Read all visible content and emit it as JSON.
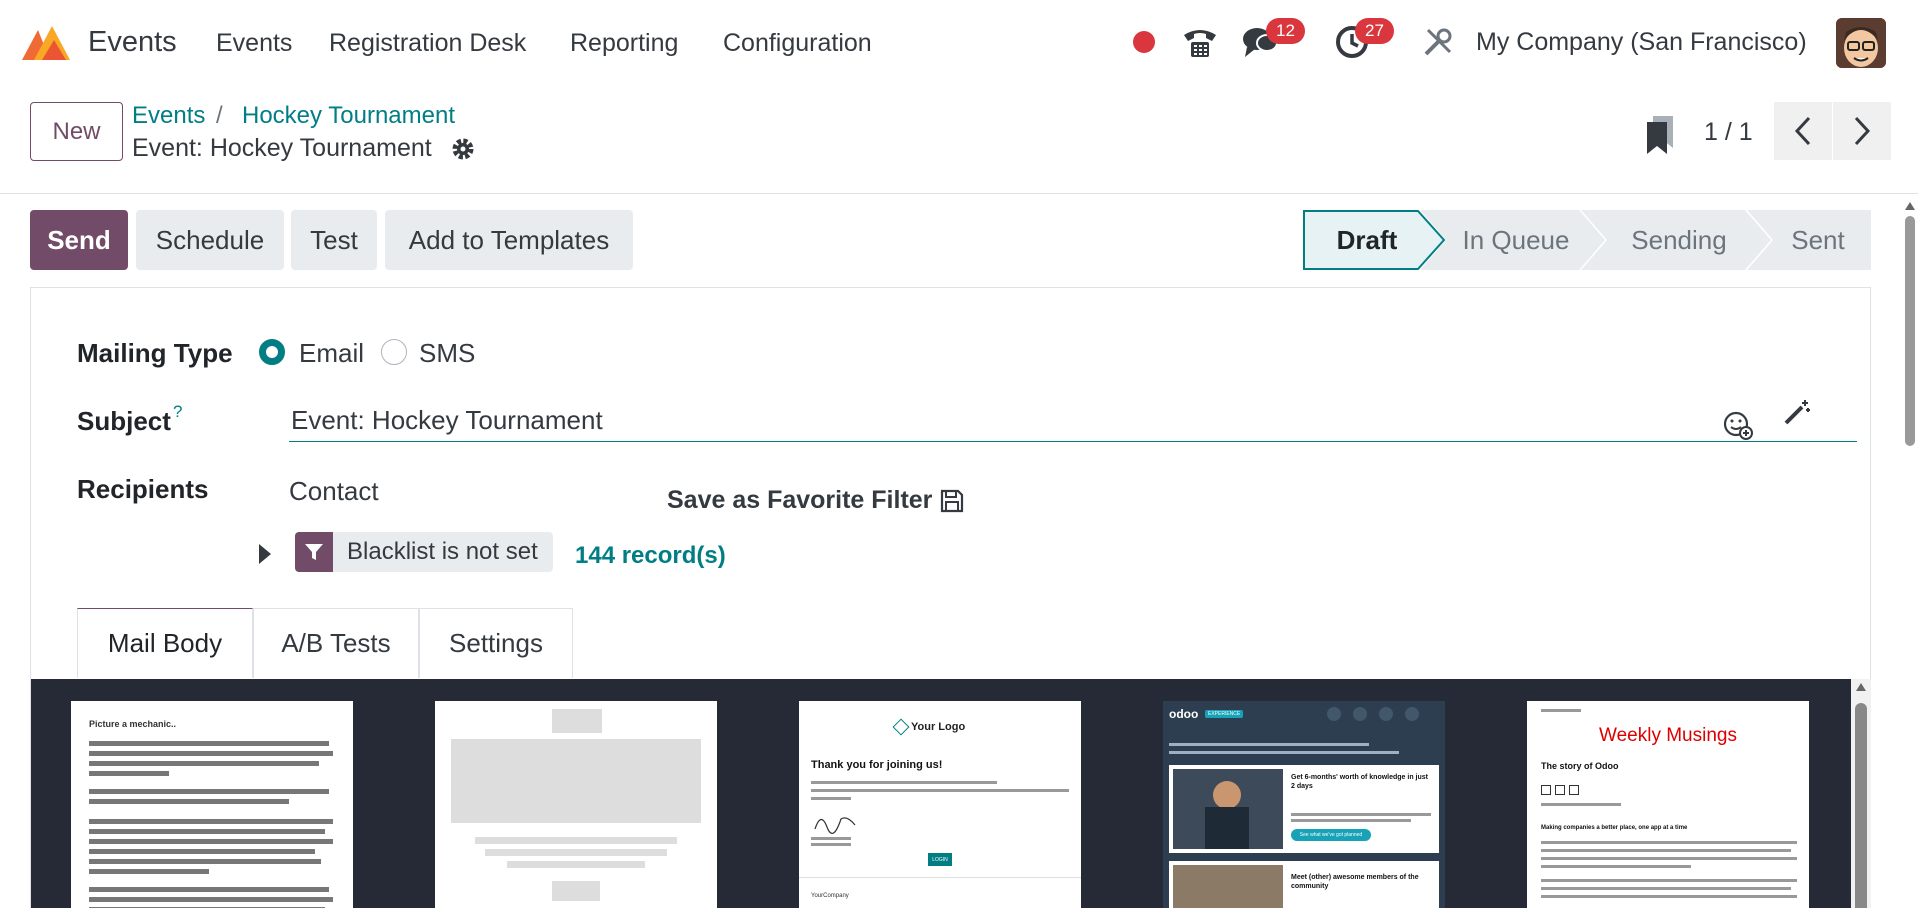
{
  "app": {
    "name": "Events"
  },
  "topnav": {
    "menu": [
      "Events",
      "Registration Desk",
      "Reporting",
      "Configuration"
    ],
    "messages_badge": "12",
    "activities_badge": "27",
    "company": "My Company (San Francisco)",
    "icons": [
      "status-dot-icon",
      "phone-icon",
      "chat-icon",
      "clock-icon",
      "debug-tools-icon"
    ]
  },
  "control": {
    "new_label": "New",
    "breadcrumb": [
      "Events",
      "Hockey Tournament"
    ],
    "record_title": "Event: Hockey Tournament",
    "pager": "1 / 1"
  },
  "actions": {
    "send": "Send",
    "schedule": "Schedule",
    "test": "Test",
    "add_templates": "Add to Templates"
  },
  "status": {
    "stages": [
      "Draft",
      "In Queue",
      "Sending",
      "Sent"
    ],
    "active": "Draft"
  },
  "form": {
    "mailing_type_label": "Mailing Type",
    "email_label": "Email",
    "sms_label": "SMS",
    "subject_label": "Subject",
    "subject_help": "?",
    "subject_value": "Event: Hockey Tournament",
    "recipients_label": "Recipients",
    "recipients_model": "Contact",
    "save_favorite": "Save as Favorite Filter",
    "filter_chip": "Blacklist is not set",
    "record_count": "144 record(s)"
  },
  "tabs": [
    "Mail Body",
    "A/B Tests",
    "Settings"
  ],
  "templates": {
    "t1_title": "Picture a mechanic..",
    "t3_logo": "Your Logo",
    "t3_heading": "Thank you for joining us!",
    "t3_button": "LOGIN",
    "t3_footer": "YourCompany",
    "t4_brand": "odoo",
    "t4_tag": "EXPERIENCE",
    "t4_item1_title": "Get 6-months' worth of knowledge in just 2 days",
    "t4_item1_btn": "See what we've got planned",
    "t4_item2_title": "Meet (other) awesome members of the community",
    "t5_title": "Weekly Musings",
    "t5_subtitle": "The story of Odoo",
    "t5_section": "Making companies a better place, one app at a time"
  },
  "colors": {
    "brand": "#714b67",
    "accent": "#017e84",
    "badge": "#d9363e",
    "gallery_bg": "#262a36"
  }
}
